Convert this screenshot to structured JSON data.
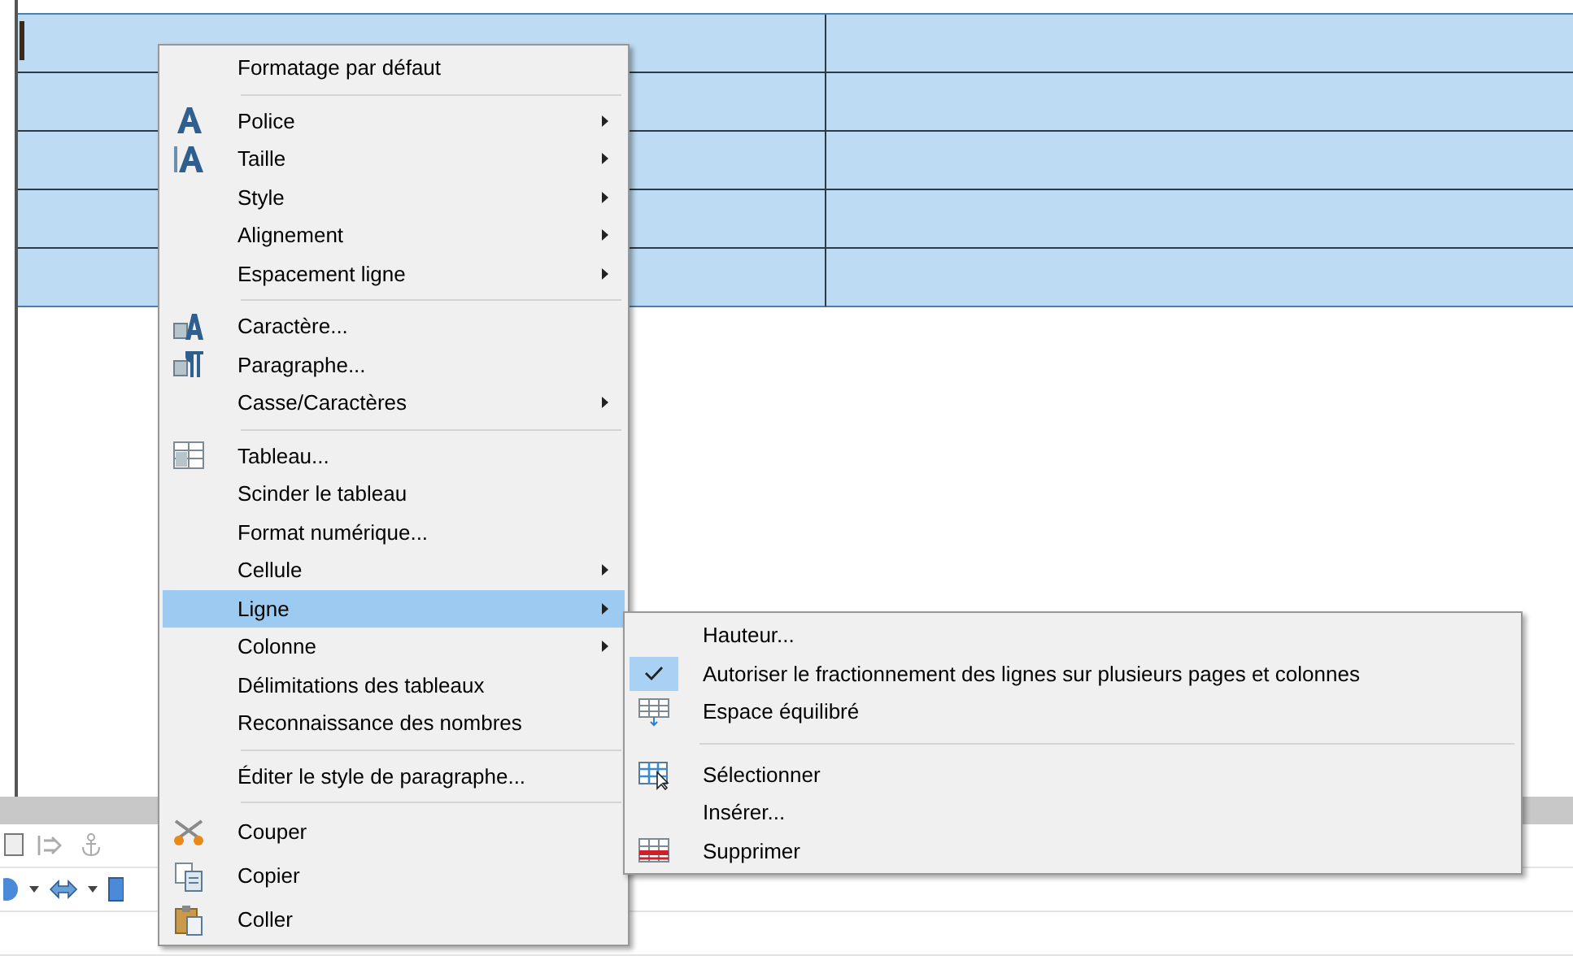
{
  "context_menu": {
    "items": [
      {
        "kind": "item",
        "label": "Formatage par défaut",
        "submenu": false,
        "selected": false
      },
      {
        "kind": "separator"
      },
      {
        "kind": "item",
        "label": "Police",
        "submenu": true,
        "selected": false
      },
      {
        "kind": "item",
        "label": "Taille",
        "submenu": true,
        "selected": false
      },
      {
        "kind": "item",
        "label": "Style",
        "submenu": true,
        "selected": false
      },
      {
        "kind": "item",
        "label": "Alignement",
        "submenu": true,
        "selected": false
      },
      {
        "kind": "item",
        "label": "Espacement ligne",
        "submenu": true,
        "selected": false
      },
      {
        "kind": "separator"
      },
      {
        "kind": "item",
        "label": "Caractère...",
        "submenu": false,
        "selected": false
      },
      {
        "kind": "item",
        "label": "Paragraphe...",
        "submenu": false,
        "selected": false
      },
      {
        "kind": "item",
        "label": "Casse/Caractères",
        "submenu": true,
        "selected": false
      },
      {
        "kind": "separator"
      },
      {
        "kind": "item",
        "label": "Tableau...",
        "submenu": false,
        "selected": false
      },
      {
        "kind": "item",
        "label": "Scinder le tableau",
        "submenu": false,
        "selected": false
      },
      {
        "kind": "item",
        "label": "Format numérique...",
        "submenu": false,
        "selected": false
      },
      {
        "kind": "item",
        "label": "Cellule",
        "submenu": true,
        "selected": false
      },
      {
        "kind": "item",
        "label": "Ligne",
        "submenu": true,
        "selected": true
      },
      {
        "kind": "item",
        "label": "Colonne",
        "submenu": true,
        "selected": false
      },
      {
        "kind": "item",
        "label": "Délimitations des tableaux",
        "submenu": false,
        "selected": false
      },
      {
        "kind": "item",
        "label": "Reconnaissance des nombres",
        "submenu": false,
        "selected": false
      },
      {
        "kind": "separator"
      },
      {
        "kind": "item",
        "label": "Éditer le style de paragraphe...",
        "submenu": false,
        "selected": false
      },
      {
        "kind": "separator"
      },
      {
        "kind": "item",
        "label": "Couper",
        "submenu": false,
        "selected": false
      },
      {
        "kind": "item",
        "label": "Copier",
        "submenu": false,
        "selected": false
      },
      {
        "kind": "item",
        "label": "Coller",
        "submenu": false,
        "selected": false
      }
    ]
  },
  "submenu": {
    "items": [
      {
        "kind": "item",
        "label": "Hauteur...",
        "checked": false
      },
      {
        "kind": "item",
        "label": "Autoriser le fractionnement des lignes sur plusieurs pages et colonnes",
        "checked": true
      },
      {
        "kind": "item",
        "label": "Espace équilibré",
        "checked": false
      },
      {
        "kind": "separator"
      },
      {
        "kind": "item",
        "label": "Sélectionner",
        "checked": false
      },
      {
        "kind": "item",
        "label": "Insérer...",
        "checked": false
      },
      {
        "kind": "item",
        "label": "Supprimer",
        "checked": false
      }
    ]
  }
}
